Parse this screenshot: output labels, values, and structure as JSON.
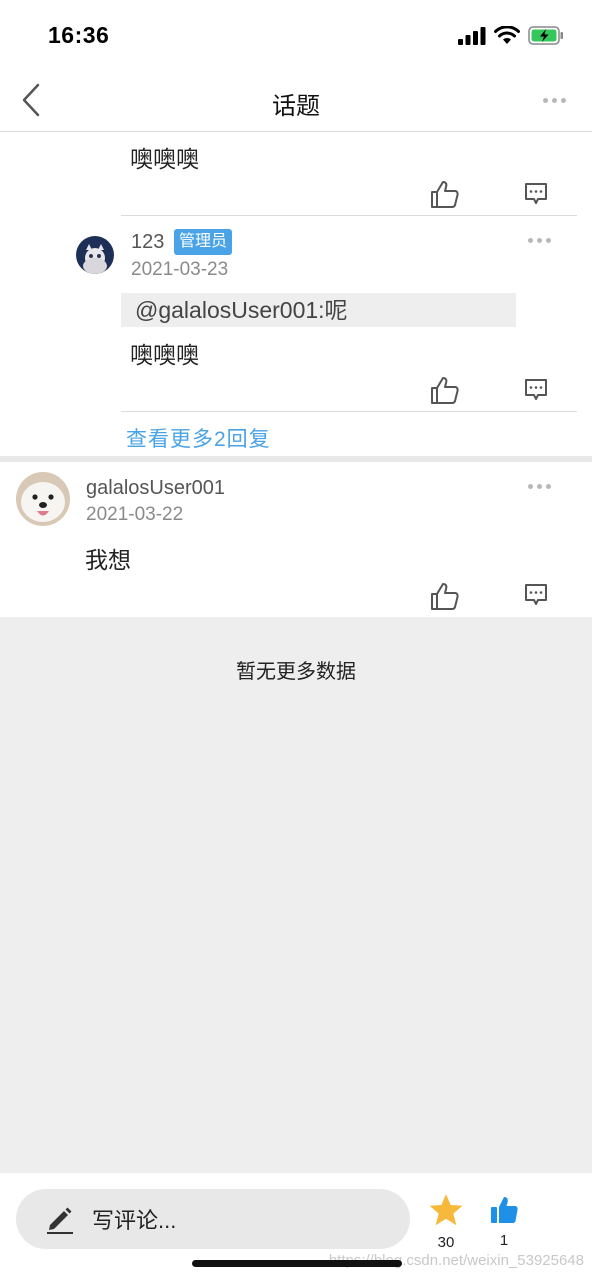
{
  "status_bar": {
    "time": "16:36"
  },
  "nav": {
    "title": "话题"
  },
  "thread": {
    "partial_reply": {
      "text": "噢噢噢"
    },
    "reply": {
      "username": "123",
      "badge": "管理员",
      "date": "2021-03-23",
      "quote": "@galalosUser001:呢",
      "text": "噢噢噢"
    },
    "more_replies": "查看更多2回复"
  },
  "comment": {
    "username": "galalosUser001",
    "date": "2021-03-22",
    "text": "我想"
  },
  "list_end": "暂无更多数据",
  "bottom_bar": {
    "placeholder": "写评论...",
    "favorites": "30",
    "likes": "1"
  },
  "watermark": "https://blog.csdn.net/weixin_53925648",
  "colors": {
    "accent": "#4aa3e6",
    "star": "#f6b93b",
    "background_gray": "#eeeeee"
  },
  "icons": [
    "back-icon",
    "more-icon",
    "like-icon",
    "reply-icon",
    "pen-icon",
    "star-icon",
    "thumbs-up-icon",
    "signal-icon",
    "wifi-icon",
    "battery-icon"
  ]
}
